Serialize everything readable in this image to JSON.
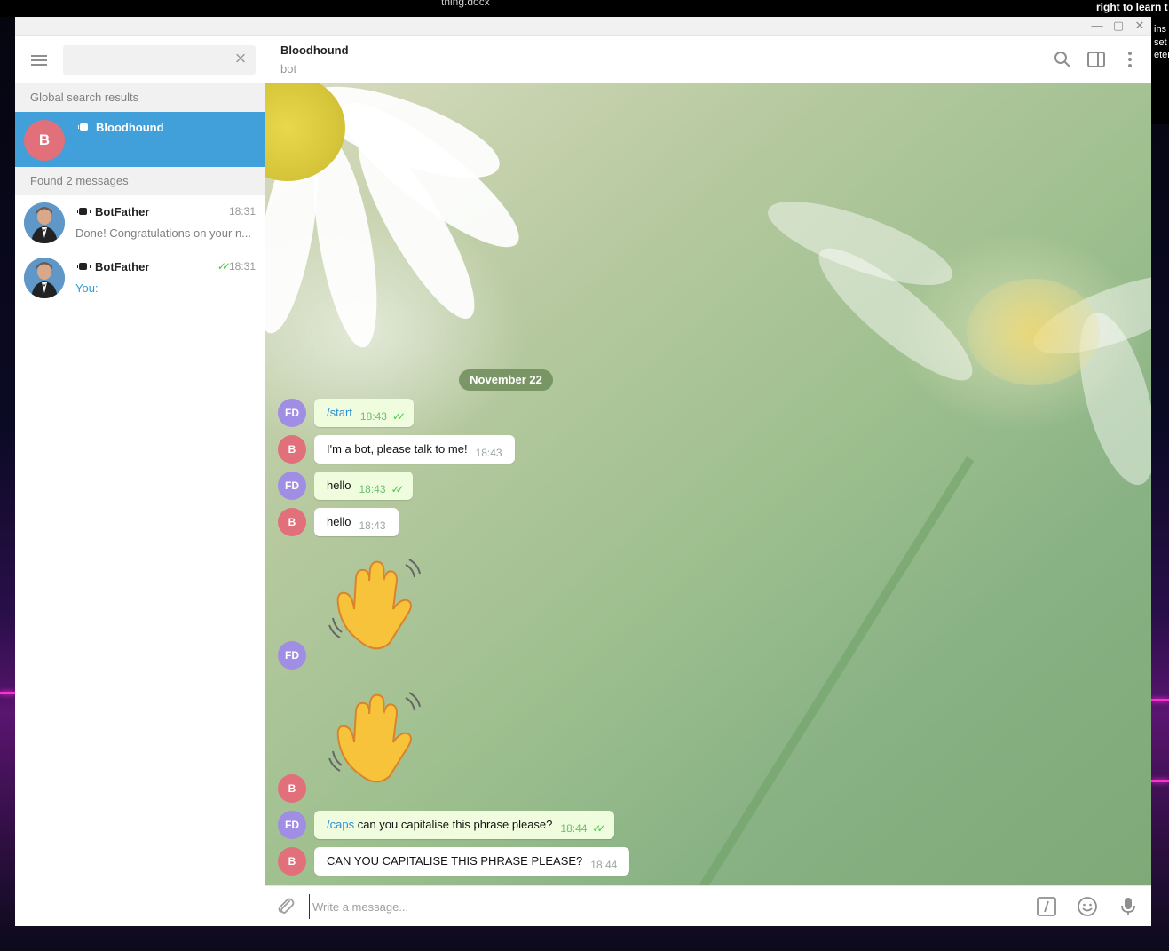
{
  "desktop": {
    "file_title": "thing.docx",
    "corner_text": "right to learn t",
    "corner_fragments": [
      "ins",
      "set",
      "eter"
    ]
  },
  "sidebar": {
    "search": {
      "value": "",
      "placeholder": ""
    },
    "global_results_header": "Global search results",
    "global_result": {
      "initial": "B",
      "name": "Bloodhound",
      "avatar_color": "#e2707a"
    },
    "found_header": "Found 2 messages",
    "found_messages": [
      {
        "name": "BotFather",
        "time": "18:31",
        "preview": "Done! Congratulations on your n...",
        "read": false
      },
      {
        "name": "BotFather",
        "time": "18:31",
        "preview": "You:",
        "read": true,
        "read_mark": "✓✓"
      }
    ]
  },
  "chat": {
    "title": "Bloodhound",
    "subtitle": "bot",
    "date": "November 22",
    "messages": [
      {
        "from": "FD",
        "type": "text",
        "command": "/start",
        "text": "",
        "time": "18:43",
        "checks": "✓✓"
      },
      {
        "from": "B",
        "type": "text",
        "text": "I'm a bot, please talk to me!",
        "time": "18:43"
      },
      {
        "from": "FD",
        "type": "text",
        "text": "hello",
        "time": "18:43",
        "checks": "✓✓"
      },
      {
        "from": "B",
        "type": "text",
        "text": "hello",
        "time": "18:43"
      },
      {
        "from": "FD",
        "type": "sticker",
        "sticker": "waving-hand"
      },
      {
        "from": "B",
        "type": "sticker",
        "sticker": "waving-hand"
      },
      {
        "from": "FD",
        "type": "text",
        "command": "/caps",
        "text": " can you capitalise this phrase please?",
        "time": "18:44",
        "checks": "✓✓"
      },
      {
        "from": "B",
        "type": "text",
        "text": "CAN YOU CAPITALISE THIS PHRASE PLEASE?",
        "time": "18:44"
      }
    ]
  },
  "composer": {
    "placeholder": "Write a message...",
    "value": ""
  },
  "colors": {
    "accent": "#419fd9",
    "fd_avatar": "#9f8ee3",
    "b_avatar": "#e2707a",
    "outgoing_bubble": "#effdde",
    "read_check": "#4dc44a"
  },
  "icons": {
    "window": [
      "minimize-icon",
      "maximize-icon",
      "close-icon"
    ],
    "header": [
      "search-icon",
      "sidebar-toggle-icon",
      "more-icon"
    ],
    "composer": [
      "attach-icon",
      "bot-command-icon",
      "emoji-icon",
      "microphone-icon"
    ]
  }
}
